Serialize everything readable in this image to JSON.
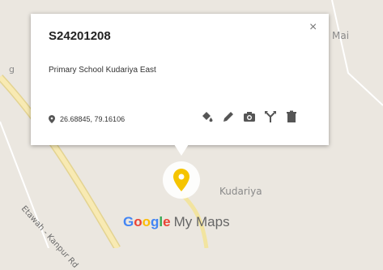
{
  "map": {
    "labels": {
      "mai": "Mai",
      "edge_left": "g",
      "kudariya": "Kudariya",
      "road": "Etawah - Kanpur Rd"
    },
    "brand": {
      "google": [
        "G",
        "o",
        "o",
        "g",
        "l",
        "e"
      ],
      "suffix": "My Maps"
    }
  },
  "popup": {
    "title": "S24201208",
    "description": "Primary School Kudariya East",
    "coordinates": "26.68845, 79.16106",
    "close_label": "×",
    "tools": [
      "paint-bucket-icon",
      "pencil-icon",
      "camera-icon",
      "directions-icon",
      "trash-icon"
    ]
  },
  "colors": {
    "marker": "#f5c400",
    "road": "#f4e3a1"
  }
}
